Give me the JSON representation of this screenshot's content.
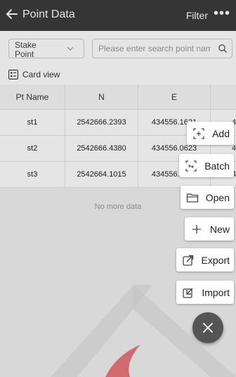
{
  "header": {
    "title": "Point Data",
    "filter_label": "Filter",
    "more_label": "•••"
  },
  "search": {
    "type_value": "Stake Point",
    "placeholder": "Please enter search point nam"
  },
  "view": {
    "card_view_label": "Card view"
  },
  "table": {
    "headers": [
      "Pt Name",
      "N",
      "E",
      ""
    ],
    "rows": [
      [
        "st1",
        "2542666.2393",
        "434556.1621",
        "4"
      ],
      [
        "st2",
        "2542666.4380",
        "434556.0623",
        "4"
      ],
      [
        "st3",
        "2542664.1015",
        "434556.0000",
        "4"
      ]
    ]
  },
  "footer": {
    "no_more": "No more data"
  },
  "fab_menu": {
    "items": [
      {
        "label": "Add",
        "icon": "add-point-icon"
      },
      {
        "label": "Batch",
        "icon": "batch-icon"
      },
      {
        "label": "Open",
        "icon": "folder-open-icon"
      },
      {
        "label": "New",
        "icon": "plus-icon"
      },
      {
        "label": "Export",
        "icon": "export-icon"
      },
      {
        "label": "Import",
        "icon": "import-icon"
      }
    ],
    "close_icon": "close-icon"
  },
  "colors": {
    "topbar": "#3c3c3c",
    "fab_close": "#555555",
    "watermark": "#e0161b"
  }
}
